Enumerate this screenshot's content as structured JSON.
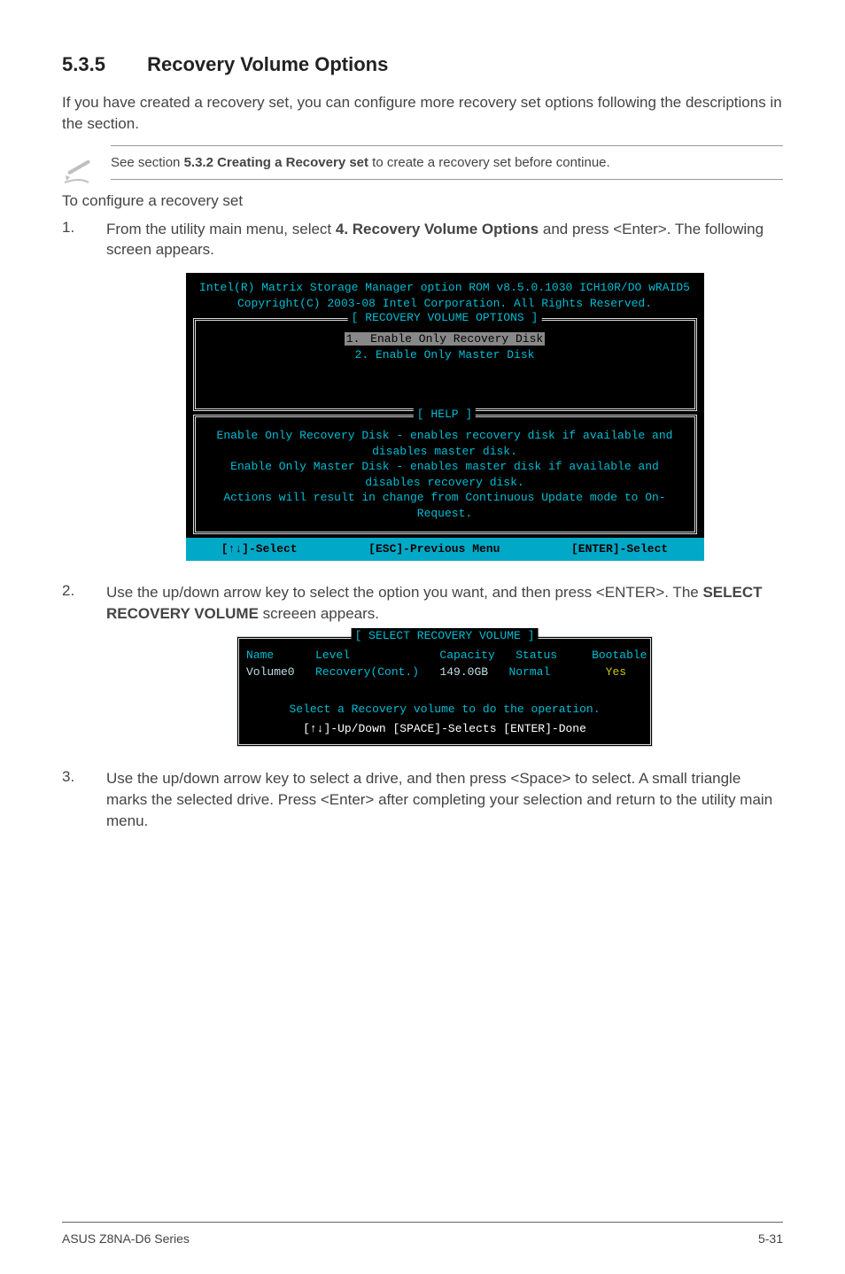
{
  "heading": {
    "number": "5.3.5",
    "title": "Recovery Volume Options"
  },
  "intro": "If you have created a recovery set, you can configure more recovery set options following the descriptions in the section.",
  "note": {
    "prefix": "See section ",
    "bold": "5.3.2 Creating a Recovery set",
    "suffix": " to create a recovery set before continue."
  },
  "subheading": "To configure a recovery set",
  "steps": {
    "s1": {
      "num": "1.",
      "before": "From the utility main menu, select ",
      "bold": "4. Recovery Volume Options",
      "after": " and press <Enter>. The following screen appears."
    },
    "s2": {
      "num": "2.",
      "before": "Use the up/down arrow key to select the option you want, and then press <ENTER>. The ",
      "bold": "SELECT RECOVERY VOLUME",
      "after": " screeen appears."
    },
    "s3": {
      "num": "3.",
      "text": "Use the up/down arrow key to select a drive, and then press <Space> to select. A small triangle marks the selected drive. Press <Enter> after completing your selection and return to the utility main menu."
    }
  },
  "terminal1": {
    "header1": "Intel(R) Matrix Storage Manager option ROM v8.5.0.1030 ICH10R/DO wRAID5",
    "header2": "Copyright(C) 2003-08 Intel Corporation.  All Rights Reserved.",
    "optionsTitle": "[ RECOVERY VOLUME OPTIONS ]",
    "opt1num": "1.",
    "opt1": " Enable Only Recovery Disk ",
    "opt2num": "2.",
    "opt2": " Enable Only Master Disk",
    "helpTitle": "[ HELP ]",
    "help1": "Enable Only Recovery Disk - enables recovery disk if available and",
    "help2": "disables master disk.",
    "help3": "Enable Only Master Disk - enables master disk if available and",
    "help4": "disables recovery disk.",
    "help5": "Actions will result in change from Continuous Update mode to On-Request.",
    "foot1": "[↑↓]-Select",
    "foot2": "[ESC]-Previous Menu",
    "foot3": "[ENTER]-Select"
  },
  "terminal2": {
    "title": "[ SELECT RECOVERY VOLUME ]",
    "cols": "Name      Level             Capacity   Status     Bootable",
    "rowName": "Volume0",
    "rowLevel": "   Recovery(Cont.)   ",
    "rowCap": "149.0GB",
    "rowStatus": "   Normal",
    "rowBoot": "        Yes",
    "msg": "Select a Recovery volume to do the operation.",
    "keys": "[↑↓]-Up/Down [SPACE]-Selects [ENTER]-Done"
  },
  "chart_data": {
    "type": "table",
    "title": "SELECT RECOVERY VOLUME",
    "columns": [
      "Name",
      "Level",
      "Capacity",
      "Status",
      "Bootable"
    ],
    "rows": [
      {
        "Name": "Volume0",
        "Level": "Recovery(Cont.)",
        "Capacity": "149.0GB",
        "Status": "Normal",
        "Bootable": "Yes"
      }
    ]
  },
  "footer": {
    "left": "ASUS Z8NA-D6 Series",
    "right": "5-31"
  }
}
